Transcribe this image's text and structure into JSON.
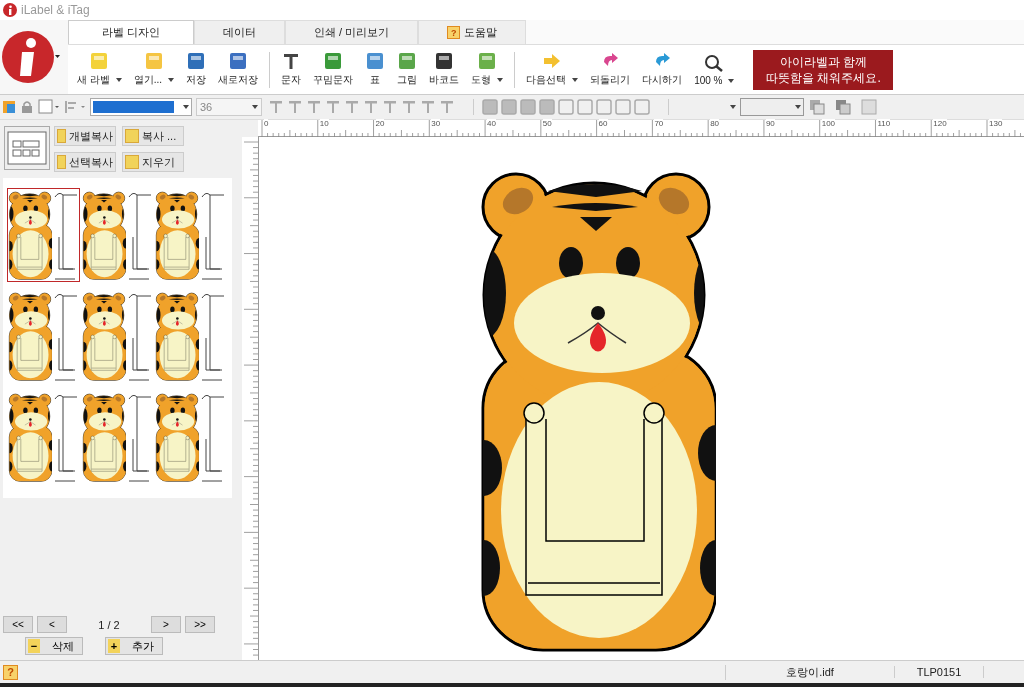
{
  "window": {
    "title": "iLabel & iTag"
  },
  "tabs": [
    {
      "label": "라벨 디자인",
      "selected": true
    },
    {
      "label": "데이터",
      "selected": false
    },
    {
      "label": "인쇄 / 미리보기",
      "selected": false
    },
    {
      "label": "도움말",
      "selected": false,
      "help_mark": "?"
    }
  ],
  "ribbon": [
    {
      "label": "새 라벨",
      "dropdown": true
    },
    {
      "label": "열기...",
      "dropdown": true
    },
    {
      "label": "저장",
      "dropdown": false
    },
    {
      "label": "새로저장",
      "dropdown": false,
      "separator_after": true
    },
    {
      "label": "문자",
      "dropdown": false
    },
    {
      "label": "꾸밈문자",
      "dropdown": false
    },
    {
      "label": "표",
      "dropdown": false
    },
    {
      "label": "그림",
      "dropdown": false
    },
    {
      "label": "바코드",
      "dropdown": false
    },
    {
      "label": "도형",
      "dropdown": true,
      "separator_after": true
    },
    {
      "label": "다음선택",
      "dropdown": true
    },
    {
      "label": "되돌리기",
      "dropdown": false
    },
    {
      "label": "다시하기",
      "dropdown": false
    },
    {
      "label": "100 %",
      "dropdown": true
    }
  ],
  "banner": {
    "lines": [
      "아이라벨과 함께",
      "따뜻함을 채워주세요."
    ]
  },
  "format_bar": {
    "font_size": "36"
  },
  "copy_buttons": [
    {
      "label": "개별복사"
    },
    {
      "label": "복사 ..."
    },
    {
      "label": "선택복사"
    },
    {
      "label": "지우기"
    }
  ],
  "thumbnails": [
    {
      "selected": true
    },
    {
      "selected": false
    },
    {
      "selected": false
    },
    {
      "selected": false
    },
    {
      "selected": false
    },
    {
      "selected": false
    },
    {
      "selected": false
    },
    {
      "selected": false
    },
    {
      "selected": false
    }
  ],
  "pager": {
    "first": "<<",
    "prev": "<",
    "page": "1 / 2",
    "next": ">",
    "last": ">>"
  },
  "page_buttons": [
    {
      "mark": "−",
      "label": "삭제"
    },
    {
      "mark": "+",
      "label": "추가"
    }
  ],
  "ruler": {
    "labels": [
      "0",
      "10",
      "20",
      "30",
      "40",
      "50",
      "60",
      "70",
      "80",
      "90",
      "100",
      "110",
      "120",
      "130"
    ]
  },
  "status_bar": {
    "help_mark": "?",
    "file": "호랑이.idf",
    "code": "TLP0151"
  }
}
